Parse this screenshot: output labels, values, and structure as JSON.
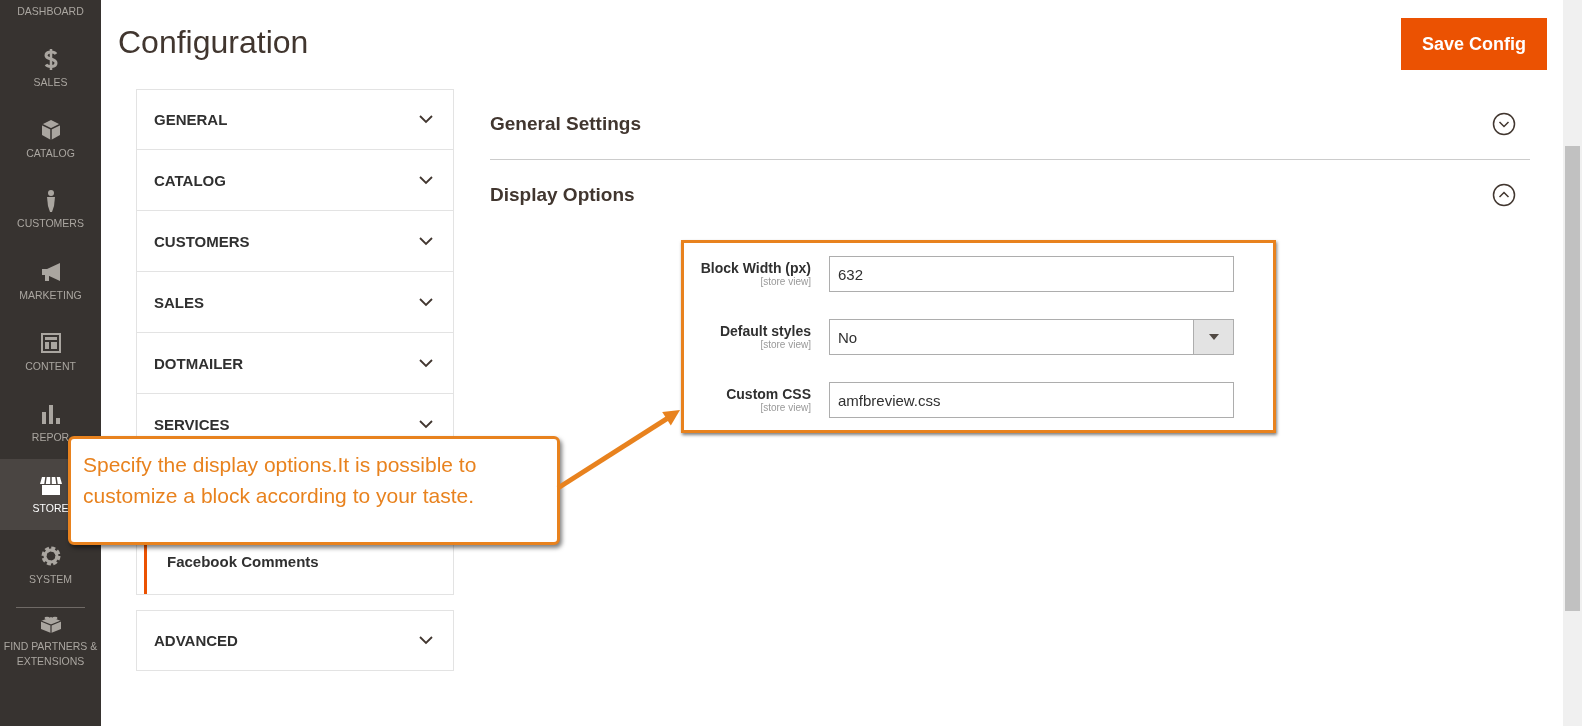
{
  "sidebar": {
    "items": [
      {
        "label": "DASHBOARD",
        "selected": false
      },
      {
        "label": "SALES",
        "selected": false
      },
      {
        "label": "CATALOG",
        "selected": false
      },
      {
        "label": "CUSTOMERS",
        "selected": false
      },
      {
        "label": "MARKETING",
        "selected": false
      },
      {
        "label": "CONTENT",
        "selected": false
      },
      {
        "label": "REPOR",
        "selected": false
      },
      {
        "label": "STORE",
        "selected": true
      },
      {
        "label": "SYSTEM",
        "selected": false
      },
      {
        "label": "FIND PARTNERS & EXTENSIONS",
        "selected": false
      }
    ]
  },
  "header": {
    "title": "Configuration",
    "save_button": "Save Config"
  },
  "config_nav": {
    "sections": [
      {
        "kind": "heading",
        "label": "GENERAL"
      },
      {
        "kind": "heading",
        "label": "CATALOG"
      },
      {
        "kind": "heading",
        "label": "CUSTOMERS"
      },
      {
        "kind": "heading",
        "label": "SALES"
      },
      {
        "kind": "heading",
        "label": "DOTMAILER"
      },
      {
        "kind": "heading",
        "label": "SERVICES"
      },
      {
        "kind": "subitem",
        "label": "Facebook Comments",
        "selected": true
      },
      {
        "kind": "heading",
        "label": "ADVANCED"
      }
    ]
  },
  "groups": [
    {
      "title": "General Settings",
      "expanded": false
    },
    {
      "title": "Display Options",
      "expanded": true,
      "fields": [
        {
          "kind": "text",
          "label": "Block Width (px)",
          "scope": "[store view]",
          "value": "632"
        },
        {
          "kind": "select",
          "label": "Default styles",
          "scope": "[store view]",
          "value": "No"
        },
        {
          "kind": "text",
          "label": "Custom CSS",
          "scope": "[store view]",
          "value": "amfbreview.css"
        }
      ]
    }
  ],
  "callout": {
    "text": "Specify the display options.It is possible to customize a block according to your taste."
  }
}
